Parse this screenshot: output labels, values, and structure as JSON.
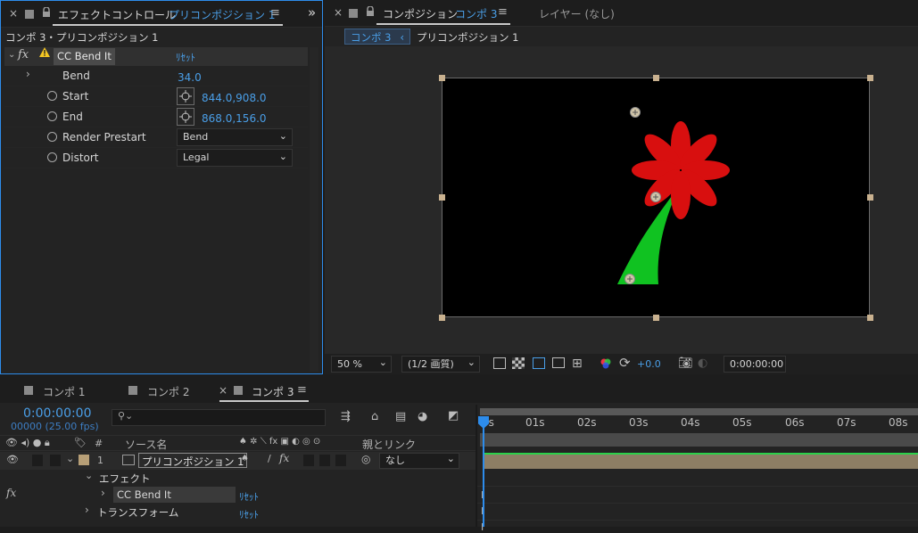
{
  "effect_panel": {
    "close": "×",
    "title_prefix": "エフェクトコントロール",
    "title_layer": "プリコンポジション 1",
    "menu": "≡",
    "collapse": "»",
    "breadcrumb": "コンポ 3・プリコンポジション 1",
    "effect_name": "CC Bend It",
    "reset": "ﾘｾｯﾄ",
    "props": [
      {
        "label": "Bend",
        "value": "34.0"
      },
      {
        "label": "Start",
        "value": "844.0,908.0"
      },
      {
        "label": "End",
        "value": "868.0,156.0"
      },
      {
        "label": "Render Prestart",
        "value": "Bend"
      },
      {
        "label": "Distort",
        "value": "Legal"
      }
    ]
  },
  "comp_panel": {
    "close": "×",
    "title_prefix": "コンポジション",
    "title_comp": "コンポ 3",
    "menu": "≡",
    "layer_tab": "レイヤー (なし)",
    "crumb_active": "コンポ 3",
    "crumb_sep": "‹",
    "crumb_next": "プリコンポジション 1",
    "toolbar": {
      "zoom": "50 %",
      "resolution": "(1/2 画質)",
      "exposure": "+0.0",
      "timecode": "0:00:00:00"
    }
  },
  "timeline": {
    "tabs": [
      {
        "label": "コンポ 1"
      },
      {
        "label": "コンポ 2"
      },
      {
        "label": "コンポ 3"
      }
    ],
    "tab_close": "×",
    "tab_menu": "≡",
    "timecode": "0:00:00:00",
    "frames": "00000 (25.00 fps)",
    "search_placeholder": "",
    "col_hash": "#",
    "col_source": "ソース名",
    "col_switches": "♠ ✲ ⟍ fx ▣ ◐ ◎ ⊙",
    "col_parent": "親とリンク",
    "layer": {
      "num": "1",
      "name": "プリコンポジション 1",
      "parent": "なし"
    },
    "effects_label": "エフェクト",
    "effect_row": "CC Bend It",
    "transform_label": "トランスフォーム",
    "reset": "ﾘｾｯﾄ",
    "ruler": [
      "0s",
      "01s",
      "02s",
      "03s",
      "04s",
      "05s",
      "06s",
      "07s",
      "08s"
    ]
  },
  "colors": {
    "accent": "#4a9fe8",
    "flower_red": "#d80f0f",
    "stem_green": "#10c221",
    "layer_bar": "#8d7e64"
  }
}
